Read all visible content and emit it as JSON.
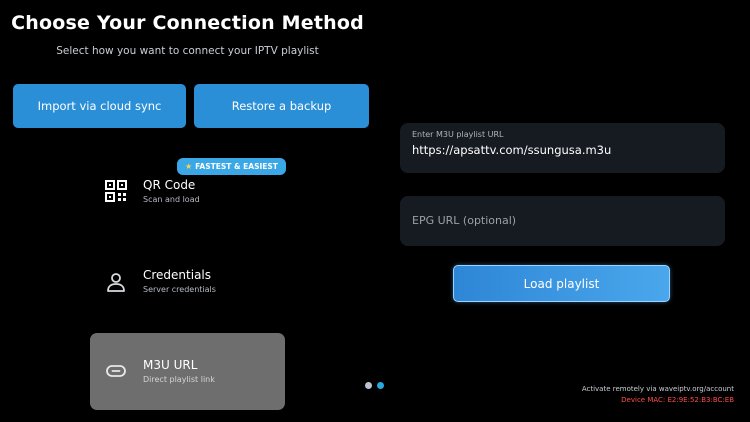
{
  "header": {
    "title": "Choose Your Connection Method",
    "subtitle": "Select how you want to connect your IPTV playlist"
  },
  "actions": {
    "import_label": "Import via cloud sync",
    "restore_label": "Restore a backup"
  },
  "badge": {
    "icon": "star-icon",
    "label": "FASTEST & EASIEST"
  },
  "methods": [
    {
      "icon": "qr-code-icon",
      "title": "QR Code",
      "subtitle": "Scan and load",
      "selected": false
    },
    {
      "icon": "user-icon",
      "title": "Credentials",
      "subtitle": "Server credentials",
      "selected": false
    },
    {
      "icon": "link-icon",
      "title": "M3U URL",
      "subtitle": "Direct playlist link",
      "selected": true
    }
  ],
  "form": {
    "url_label": "Enter M3U playlist URL",
    "url_value": "https://apsattv.com/ssungusa.m3u",
    "epg_placeholder": "EPG URL (optional)",
    "load_label": "Load playlist"
  },
  "pager": {
    "pages": 2,
    "active": 2
  },
  "footer": {
    "remote_text": "Activate remotely via waveiptv.org/account",
    "mac_text": "Device MAC: E2:9E:52:B3:BC:EB"
  },
  "colors": {
    "background": "#000000",
    "accent_blue": "#2b8fd8",
    "selected_method": "#6e6e6e",
    "input_bg": "#161b22",
    "mac_red": "#ff4b4b"
  }
}
